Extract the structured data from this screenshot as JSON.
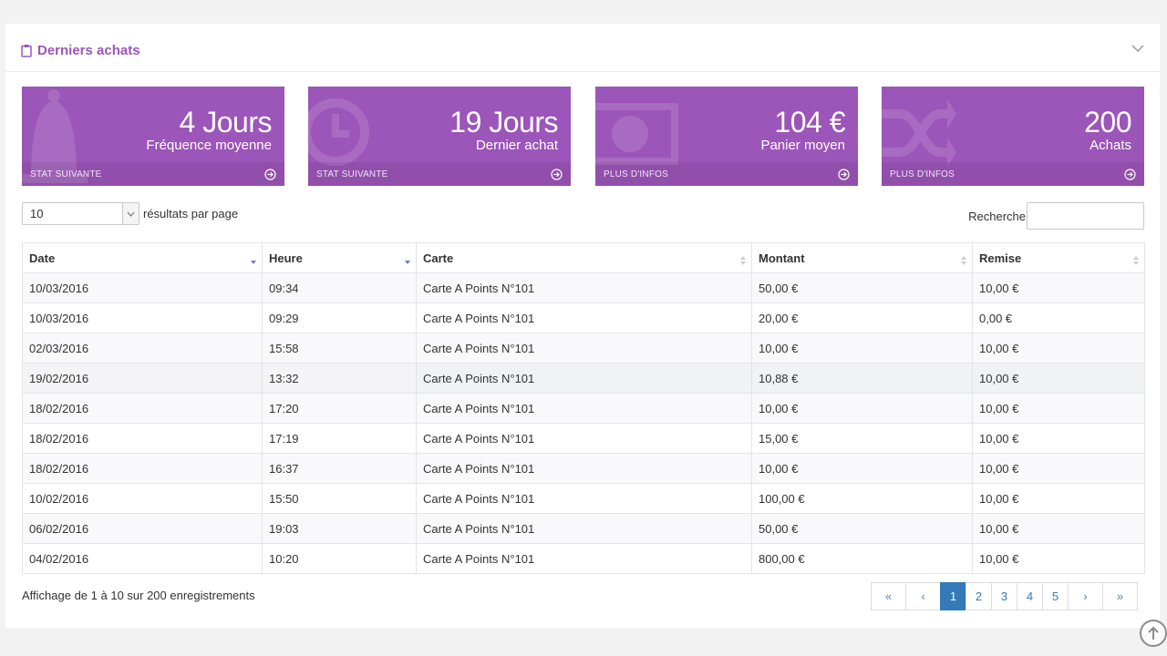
{
  "panel": {
    "title": "Derniers achats"
  },
  "stats": [
    {
      "value": "4 Jours",
      "label": "Fréquence moyenne",
      "footer": "Stat suivante",
      "bg_icon": "bell-icon"
    },
    {
      "value": "19 Jours",
      "label": "Dernier achat",
      "footer": "Stat suivante",
      "bg_icon": "clock-icon"
    },
    {
      "value": "104 €",
      "label": "Panier moyen",
      "footer": "Plus d'infos",
      "bg_icon": "money-icon"
    },
    {
      "value": "200",
      "label": "Achats",
      "footer": "Plus d'infos",
      "bg_icon": "shuffle-icon"
    }
  ],
  "length": {
    "selected": "10",
    "label": "résultats par page"
  },
  "search": {
    "label": "Recherche",
    "value": ""
  },
  "table": {
    "columns": [
      "Date",
      "Heure",
      "Carte",
      "Montant",
      "Remise"
    ],
    "rows": [
      [
        "10/03/2016",
        "09:34",
        "Carte A Points N°101",
        "50,00 €",
        "10,00 €"
      ],
      [
        "10/03/2016",
        "09:29",
        "Carte A Points N°101",
        "20,00 €",
        "0,00 €"
      ],
      [
        "02/03/2016",
        "15:58",
        "Carte A Points N°101",
        "10,00 €",
        "10,00 €"
      ],
      [
        "19/02/2016",
        "13:32",
        "Carte A Points N°101",
        "10,88 €",
        "10,00 €"
      ],
      [
        "18/02/2016",
        "17:20",
        "Carte A Points N°101",
        "10,00 €",
        "10,00 €"
      ],
      [
        "18/02/2016",
        "17:19",
        "Carte A Points N°101",
        "15,00 €",
        "10,00 €"
      ],
      [
        "18/02/2016",
        "16:37",
        "Carte A Points N°101",
        "10,00 €",
        "10,00 €"
      ],
      [
        "10/02/2016",
        "15:50",
        "Carte A Points N°101",
        "100,00 €",
        "10,00 €"
      ],
      [
        "06/02/2016",
        "19:03",
        "Carte A Points N°101",
        "50,00 €",
        "10,00 €"
      ],
      [
        "04/02/2016",
        "10:20",
        "Carte A Points N°101",
        "800,00 €",
        "10,00 €"
      ]
    ]
  },
  "info": "Affichage de 1 à 10 sur 200 enregistrements",
  "pagination": {
    "first": "«",
    "prev": "‹",
    "pages": [
      "1",
      "2",
      "3",
      "4",
      "5"
    ],
    "active": "1",
    "next": "›",
    "last": "»"
  },
  "colors": {
    "accent": "#9c55b8",
    "link": "#337ab7"
  }
}
